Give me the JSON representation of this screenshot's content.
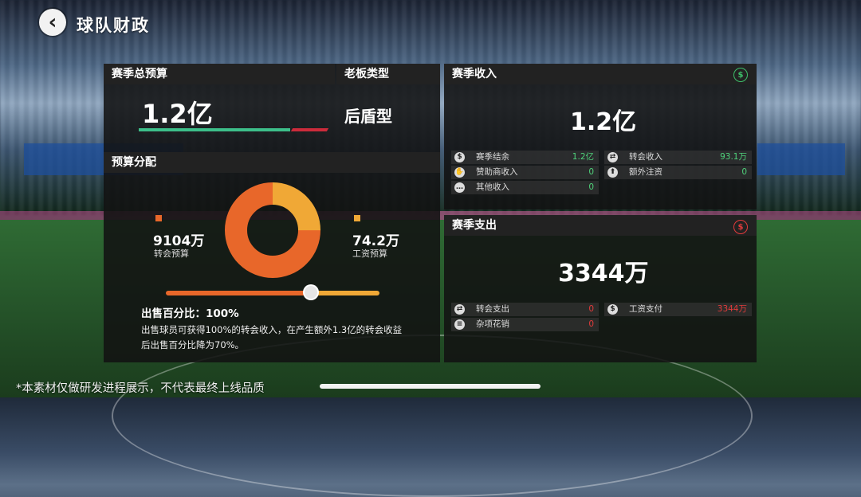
{
  "header": {
    "title": "球队财政",
    "back_glyph": "‹"
  },
  "budget": {
    "section_title": "赛季总预算",
    "total": "1.2亿",
    "owner_type_title": "老板类型",
    "owner_type": "后盾型",
    "bar_colors": {
      "used": "#3dbf8a",
      "rest": "#cc2b3b"
    }
  },
  "allocation": {
    "section_title": "预算分配",
    "transfer": {
      "value": "9104万",
      "label": "转会预算",
      "color": "#e8672a"
    },
    "wage": {
      "value": "74.2万",
      "label": "工资预算",
      "color": "#f0a836"
    },
    "donut": {
      "transfer_share": 0.75,
      "wage_share": 0.25
    },
    "slider_level": 0.68,
    "sell_title": "出售百分比：100%",
    "sell_desc": "出售球员可获得100%的转会收入，在产生额外1.3亿的转会收益后出售百分比降为70%。"
  },
  "income": {
    "section_title": "赛季收入",
    "total": "1.2亿",
    "header_icon": "income-coin-icon",
    "rows_left": [
      {
        "icon": "coin-icon",
        "glyph": "$",
        "label": "赛季结余",
        "value": "1.2亿"
      },
      {
        "icon": "handshake-icon",
        "glyph": "✋",
        "label": "赞助商收入",
        "value": "0"
      },
      {
        "icon": "other-icon",
        "glyph": "…",
        "label": "其他收入",
        "value": "0"
      }
    ],
    "rows_right": [
      {
        "icon": "transfer-icon",
        "glyph": "⇄",
        "label": "转会收入",
        "value": "93.1万"
      },
      {
        "icon": "injection-icon",
        "glyph": "⬆",
        "label": "额外注资",
        "value": "0"
      }
    ],
    "value_color": "#4fd17a"
  },
  "expense": {
    "section_title": "赛季支出",
    "total": "3344万",
    "header_icon": "expense-coin-icon",
    "rows_left": [
      {
        "icon": "transfer-out-icon",
        "glyph": "⇄",
        "label": "转会支出",
        "value": "0"
      },
      {
        "icon": "misc-icon",
        "glyph": "≡",
        "label": "杂项花销",
        "value": "0"
      }
    ],
    "rows_right": [
      {
        "icon": "wage-coin-icon",
        "glyph": "$",
        "label": "工资支付",
        "value": "3344万"
      }
    ],
    "value_color": "#e23b3b"
  },
  "footer": {
    "note": "*本素材仅做研发进程展示，不代表最终上线品质"
  }
}
